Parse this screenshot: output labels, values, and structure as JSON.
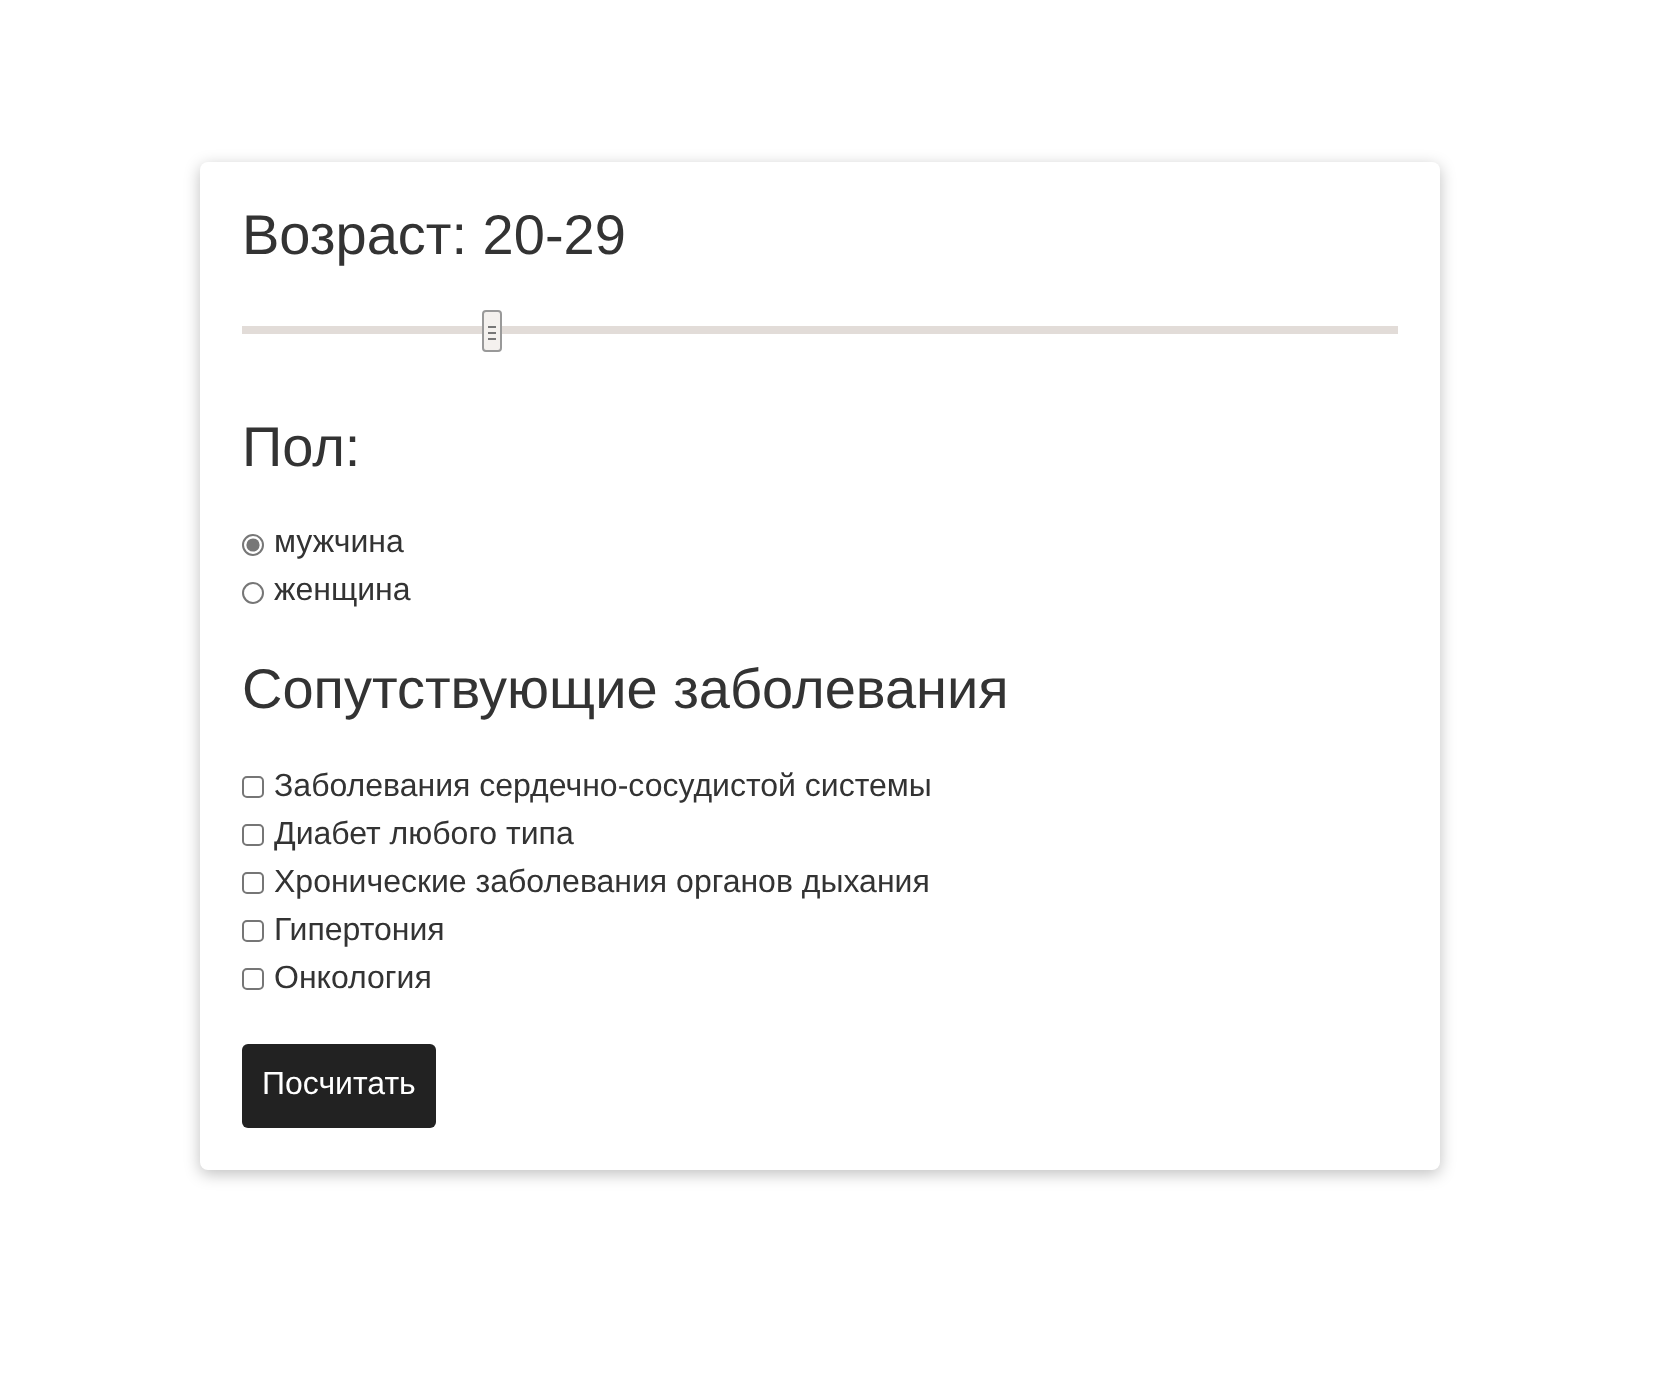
{
  "age": {
    "title": "Возраст: 20-29",
    "level": 0.217
  },
  "sex": {
    "title": "Пол:",
    "options": [
      {
        "label": "мужчина",
        "selected": true
      },
      {
        "label": "женщина",
        "selected": false
      }
    ]
  },
  "conditions": {
    "title": "Сопутствующие заболевания",
    "items": [
      {
        "label": "Заболевания сердечно-сосудистой системы",
        "checked": false
      },
      {
        "label": "Диабет любого типа",
        "checked": false
      },
      {
        "label": "Хронические заболевания органов дыхания",
        "checked": false
      },
      {
        "label": "Гипертония",
        "checked": false
      },
      {
        "label": "Онкология",
        "checked": false
      }
    ]
  },
  "button": "Посчитать"
}
